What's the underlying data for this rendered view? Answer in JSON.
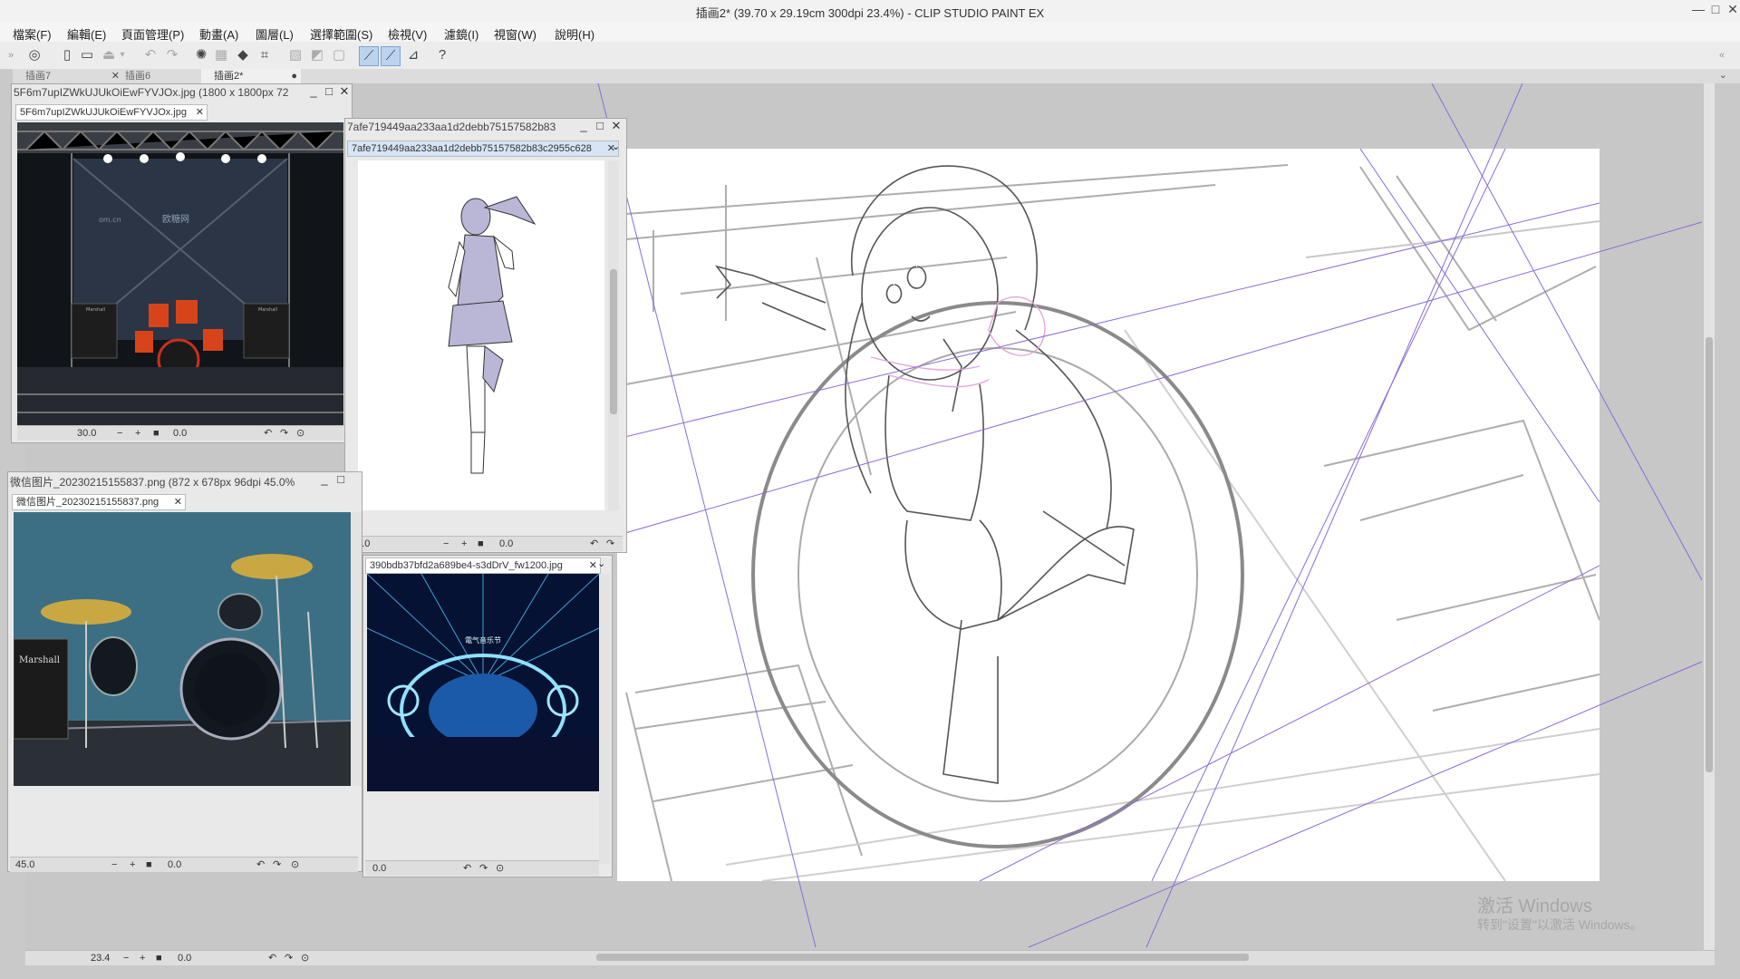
{
  "window": {
    "title": "插画2* (39.70 x 29.19cm 300dpi 23.4%)  - CLIP STUDIO PAINT EX",
    "minimize": "—",
    "maximize": "□",
    "close": "✕"
  },
  "menu": [
    {
      "label": "檔案(F)"
    },
    {
      "label": "編輯(E)"
    },
    {
      "label": "頁面管理(P)"
    },
    {
      "label": "動畫(A)"
    },
    {
      "label": "圖層(L)"
    },
    {
      "label": "選擇範圍(S)"
    },
    {
      "label": "檢視(V)"
    },
    {
      "label": "濾鏡(I)"
    },
    {
      "label": "視窗(W)"
    },
    {
      "label": "說明(H)"
    }
  ],
  "document_tabs": [
    {
      "label": "插画7",
      "close": "✕"
    },
    {
      "label": "插画6",
      "close": "✕"
    },
    {
      "label": "插画2*",
      "close": "●"
    }
  ],
  "sub_windows": {
    "stage": {
      "title": "5F6m7upIZWkUJUkOiEwFYVJOx.jpg (1800 x 1800px 72",
      "tab": "5F6m7upIZWkUJUkOiEwFYVJOx.jpg",
      "zoom": "30.0",
      "rotation": "0.0"
    },
    "sketch": {
      "title": "7afe719449aa233aa1d2debb75157582b83",
      "tab": "7afe719449aa233aa1d2debb75157582b83c2955c628",
      "zoom": "33.0",
      "rotation": "0.0"
    },
    "drums": {
      "title": "微信图片_20230215155837.png (872 x 678px 96dpi 45.0%",
      "tab": "微信图片_20230215155837.png",
      "zoom": "45.0",
      "rotation": "0.0"
    },
    "concert": {
      "tab": "390bdb37bfd2a689be4-s3dDrV_fw1200.jpg",
      "rotation": "0.0"
    }
  },
  "stage_labels": {
    "brand": "欧糖网",
    "url": "om.cn",
    "amp": "Marshall"
  },
  "drum_labels": {
    "amp": "Marshall"
  },
  "concert_labels": {
    "banner": "電气音乐节"
  },
  "main_status": {
    "zoom": "23.4",
    "rotation": "0.0"
  },
  "activation": {
    "title": "激活 Windows",
    "subtitle": "转到\"设置\"以激活 Windows。"
  }
}
